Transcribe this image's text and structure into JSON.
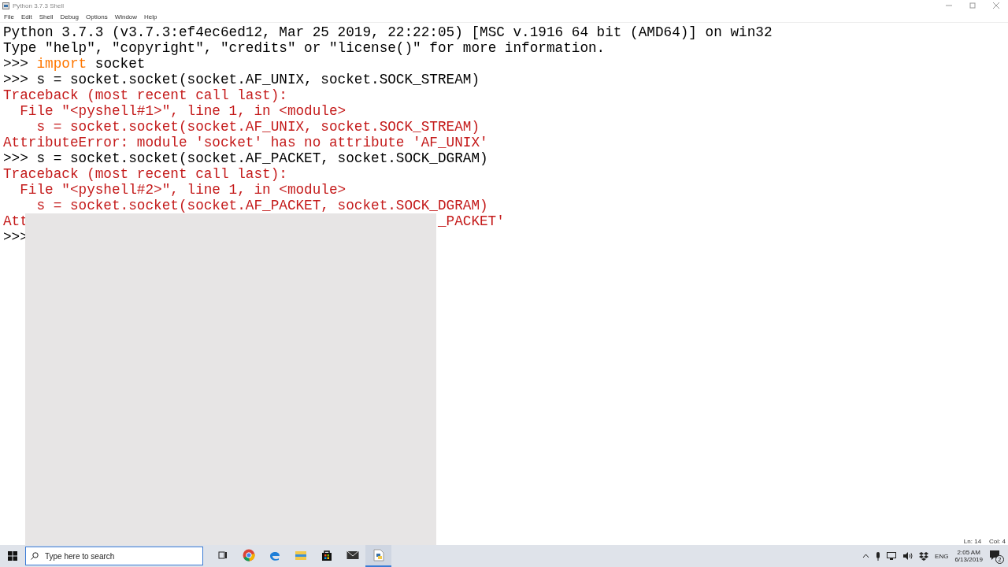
{
  "window": {
    "title": "Python 3.7.3 Shell"
  },
  "menu": [
    "File",
    "Edit",
    "Shell",
    "Debug",
    "Options",
    "Window",
    "Help"
  ],
  "shell_lines": [
    {
      "segments": [
        {
          "kind": "output",
          "text": "Python 3.7.3 (v3.7.3:ef4ec6ed12, Mar 25 2019, 22:22:05) [MSC v.1916 64 bit (AMD64)] on win32"
        }
      ]
    },
    {
      "segments": [
        {
          "kind": "output",
          "text": "Type \"help\", \"copyright\", \"credits\" or \"license()\" for more information."
        }
      ]
    },
    {
      "segments": [
        {
          "kind": "output",
          "text": ">>> "
        },
        {
          "kind": "keyword",
          "text": "import"
        },
        {
          "kind": "output",
          "text": " socket"
        }
      ]
    },
    {
      "segments": [
        {
          "kind": "output",
          "text": ">>> s = socket.socket(socket.AF_UNIX, socket.SOCK_STREAM)"
        }
      ]
    },
    {
      "segments": [
        {
          "kind": "error",
          "text": "Traceback (most recent call last):"
        }
      ]
    },
    {
      "segments": [
        {
          "kind": "error",
          "text": "  File \"<pyshell#1>\", line 1, in <module>"
        }
      ]
    },
    {
      "segments": [
        {
          "kind": "error",
          "text": "    s = socket.socket(socket.AF_UNIX, socket.SOCK_STREAM)"
        }
      ]
    },
    {
      "segments": [
        {
          "kind": "error",
          "text": "AttributeError: module 'socket' has no attribute 'AF_UNIX'"
        }
      ]
    },
    {
      "segments": [
        {
          "kind": "output",
          "text": ">>> s = socket.socket(socket.AF_PACKET, socket.SOCK_DGRAM)"
        }
      ]
    },
    {
      "segments": [
        {
          "kind": "error",
          "text": "Traceback (most recent call last):"
        }
      ]
    },
    {
      "segments": [
        {
          "kind": "error",
          "text": "  File \"<pyshell#2>\", line 1, in <module>"
        }
      ]
    },
    {
      "segments": [
        {
          "kind": "error",
          "text": "    s = socket.socket(socket.AF_PACKET, socket.SOCK_DGRAM)"
        }
      ]
    },
    {
      "segments": [
        {
          "kind": "error",
          "text": "Att"
        },
        {
          "kind": "error_after_cover",
          "text": "_PACKET'"
        }
      ]
    },
    {
      "segments": [
        {
          "kind": "output",
          "text": ">>>"
        }
      ]
    }
  ],
  "status_bar": {
    "line": "Ln: 14",
    "column": "Col: 4"
  },
  "taskbar": {
    "search": {
      "placeholder": "Type here to search"
    },
    "apps": [
      {
        "kind": "task-view",
        "selected": false
      },
      {
        "kind": "chrome",
        "selected": false
      },
      {
        "kind": "edge",
        "selected": false
      },
      {
        "kind": "explorer",
        "selected": false
      },
      {
        "kind": "store",
        "selected": false
      },
      {
        "kind": "mail",
        "selected": false
      },
      {
        "kind": "python",
        "selected": true
      }
    ],
    "tray": {
      "language": "ENG",
      "time": "2:05 AM",
      "date": "6/13/2019",
      "notifications": "2"
    }
  }
}
